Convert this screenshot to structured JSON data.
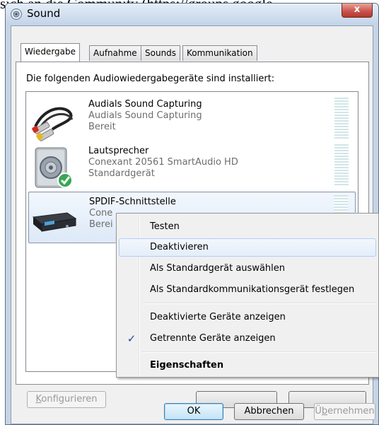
{
  "background_text": "sich an die Community (https://groups.google",
  "window": {
    "title": "Sound",
    "close_label": "x"
  },
  "tabs": [
    {
      "label": "Wiedergabe",
      "active": true
    },
    {
      "label": "Aufnahme",
      "active": false
    },
    {
      "label": "Sounds",
      "active": false
    },
    {
      "label": "Kommunikation",
      "active": false
    }
  ],
  "panel": {
    "intro": "Die folgenden Audiowiedergabegeräte sind installiert:"
  },
  "devices": [
    {
      "name": "Audials Sound Capturing",
      "line2": "Audials Sound Capturing",
      "line3": "Bereit",
      "icon": "rca-cable-icon"
    },
    {
      "name": "Lautsprecher",
      "line2": "Conexant 20561 SmartAudio HD",
      "line3": "Standardgerät",
      "icon": "speaker-icon",
      "badge": "default-check-icon"
    },
    {
      "name": "SPDIF-Schnittstelle",
      "line2": "Cone",
      "line3": "Berei",
      "icon": "spdif-device-icon",
      "selected": true
    }
  ],
  "buttons": {
    "configure": {
      "accesskey": "K",
      "rest": "onfigurieren"
    },
    "ok": "OK",
    "cancel": "Abbrechen",
    "apply": {
      "prefix": "Ü",
      "accesskey": "b",
      "rest": "ernehmen"
    }
  },
  "context_menu": {
    "items": [
      {
        "label": "Testen"
      },
      {
        "label": "Deaktivieren",
        "hover": true
      },
      {
        "label": "Als Standardgerät auswählen"
      },
      {
        "label": "Als Standardkommunikationsgerät festlegen"
      },
      {
        "label": "Deaktivierte Geräte anzeigen"
      },
      {
        "label": "Getrennte Geräte anzeigen",
        "checked": true,
        "check_glyph": "✓"
      },
      {
        "label": "Eigenschaften",
        "bold": true
      }
    ]
  },
  "colors": {
    "accent": "#3c7fb1",
    "disabled_text": "#9a9a9a",
    "secondary_text": "#6d6d6d"
  }
}
